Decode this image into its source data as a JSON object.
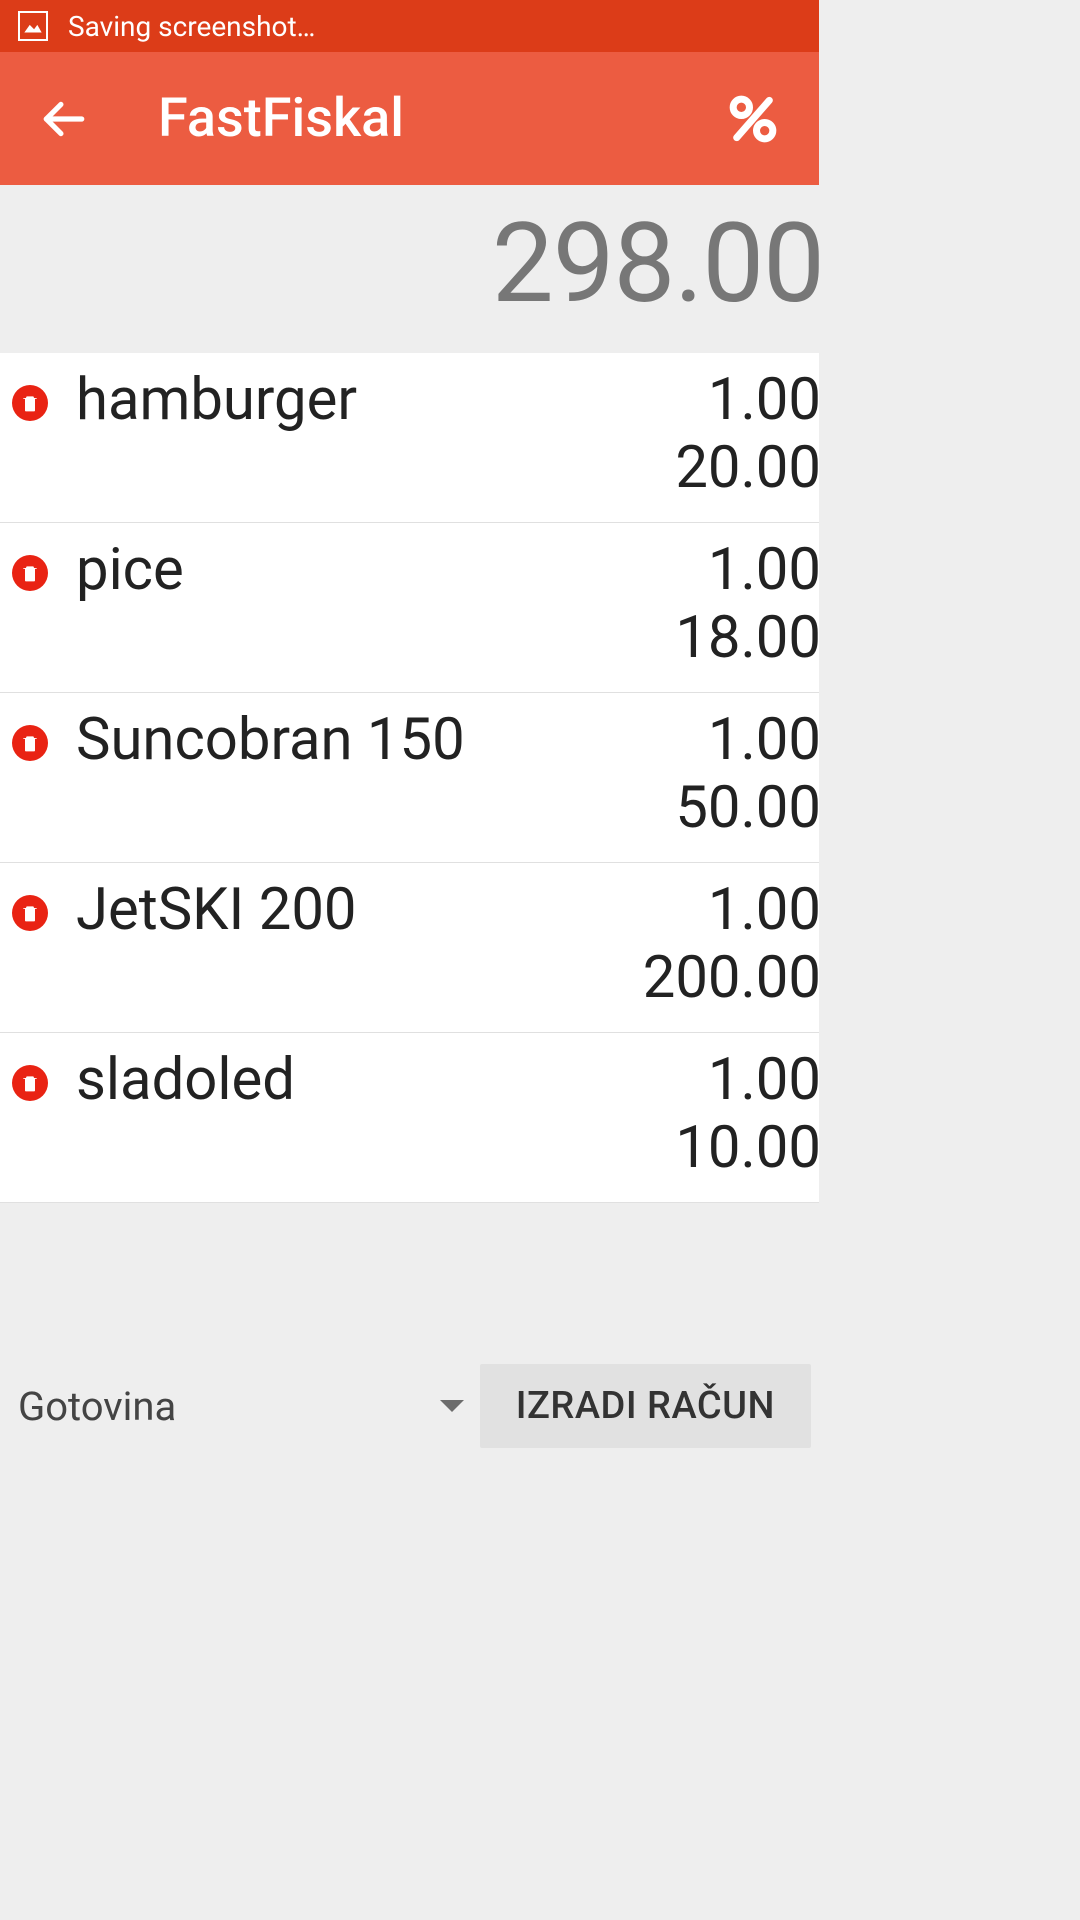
{
  "status_bar": {
    "text": "Saving screenshot…"
  },
  "header": {
    "title": "FastFiskal"
  },
  "total": "298.00",
  "items": [
    {
      "name": "hamburger",
      "qty": "1.00",
      "price": "20.00"
    },
    {
      "name": "pice",
      "qty": "1.00",
      "price": "18.00"
    },
    {
      "name": "Suncobran 150",
      "qty": "1.00",
      "price": "50.00"
    },
    {
      "name": "JetSKI 200",
      "qty": "1.00",
      "price": "200.00"
    },
    {
      "name": "sladoled",
      "qty": "1.00",
      "price": "10.00"
    }
  ],
  "footer": {
    "payment_method": "Gotovina",
    "create_button": "IZRADI RAČUN"
  }
}
